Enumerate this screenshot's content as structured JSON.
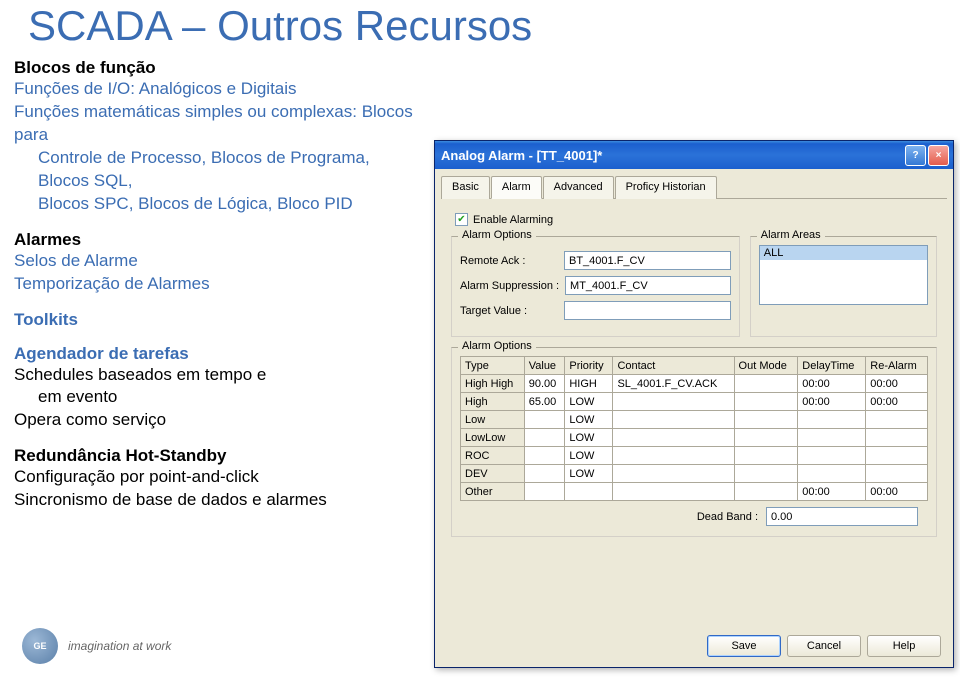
{
  "slide": {
    "title": "SCADA – Outros Recursos",
    "sections": {
      "blocos": {
        "heading": "Blocos de função",
        "line1": "Funções de I/O: Analógicos e Digitais",
        "line2a": "Funções matemáticas simples ou complexas: Blocos para",
        "line2b": "Controle de Processo, Blocos de Programa, Blocos SQL,",
        "line2c": "Blocos SPC, Blocos de Lógica, Bloco PID"
      },
      "alarmes": {
        "heading": "Alarmes",
        "line1": "Selos de Alarme",
        "line2": "Temporização de Alarmes"
      },
      "toolkits": {
        "heading": "Toolkits"
      },
      "agendador": {
        "heading": "Agendador de tarefas",
        "line1": "Schedules baseados em tempo e",
        "line1b": "em evento",
        "line2": "Opera como serviço"
      },
      "redundancia": {
        "heading": "Redundância Hot-Standby",
        "line1": "Configuração por point-and-click",
        "line2": "Sincronismo de base de dados e alarmes"
      }
    },
    "logo_tagline": "imagination at work"
  },
  "dialog": {
    "title": "Analog Alarm - [TT_4001]*",
    "tabs": [
      "Basic",
      "Alarm",
      "Advanced",
      "Proficy Historian"
    ],
    "active_tab_index": 1,
    "enable_alarming_label": "Enable Alarming",
    "enable_alarming_checked": "✔",
    "alarm_options": {
      "legend": "Alarm Options",
      "remote_ack_label": "Remote Ack :",
      "remote_ack_value": "BT_4001.F_CV",
      "suppression_label": "Alarm Suppression :",
      "suppression_value": "MT_4001.F_CV",
      "target_label": "Target Value :",
      "target_value": ""
    },
    "alarm_areas": {
      "legend": "Alarm Areas",
      "items": [
        "ALL"
      ]
    },
    "grid_legend": "Alarm Options",
    "grid": {
      "headers": [
        "Type",
        "Value",
        "Priority",
        "Contact",
        "Out Mode",
        "DelayTime",
        "Re-Alarm"
      ],
      "rows": [
        {
          "type": "High High",
          "value": "90.00",
          "priority": "HIGH",
          "contact": "SL_4001.F_CV.ACK",
          "outmode": "",
          "delay": "00:00",
          "realarm": "00:00"
        },
        {
          "type": "High",
          "value": "65.00",
          "priority": "LOW",
          "contact": "",
          "outmode": "",
          "delay": "00:00",
          "realarm": "00:00"
        },
        {
          "type": "Low",
          "value": "",
          "priority": "LOW",
          "contact": "",
          "outmode": "",
          "delay": "",
          "realarm": ""
        },
        {
          "type": "LowLow",
          "value": "",
          "priority": "LOW",
          "contact": "",
          "outmode": "",
          "delay": "",
          "realarm": ""
        },
        {
          "type": "ROC",
          "value": "",
          "priority": "LOW",
          "contact": "",
          "outmode": "",
          "delay": "",
          "realarm": ""
        },
        {
          "type": "DEV",
          "value": "",
          "priority": "LOW",
          "contact": "",
          "outmode": "",
          "delay": "",
          "realarm": ""
        },
        {
          "type": "Other",
          "value": "",
          "priority": "",
          "contact": "",
          "outmode": "",
          "delay": "00:00",
          "realarm": "00:00"
        }
      ]
    },
    "deadband_label": "Dead Band :",
    "deadband_value": "0.00",
    "buttons": {
      "save": "Save",
      "cancel": "Cancel",
      "help": "Help"
    }
  }
}
